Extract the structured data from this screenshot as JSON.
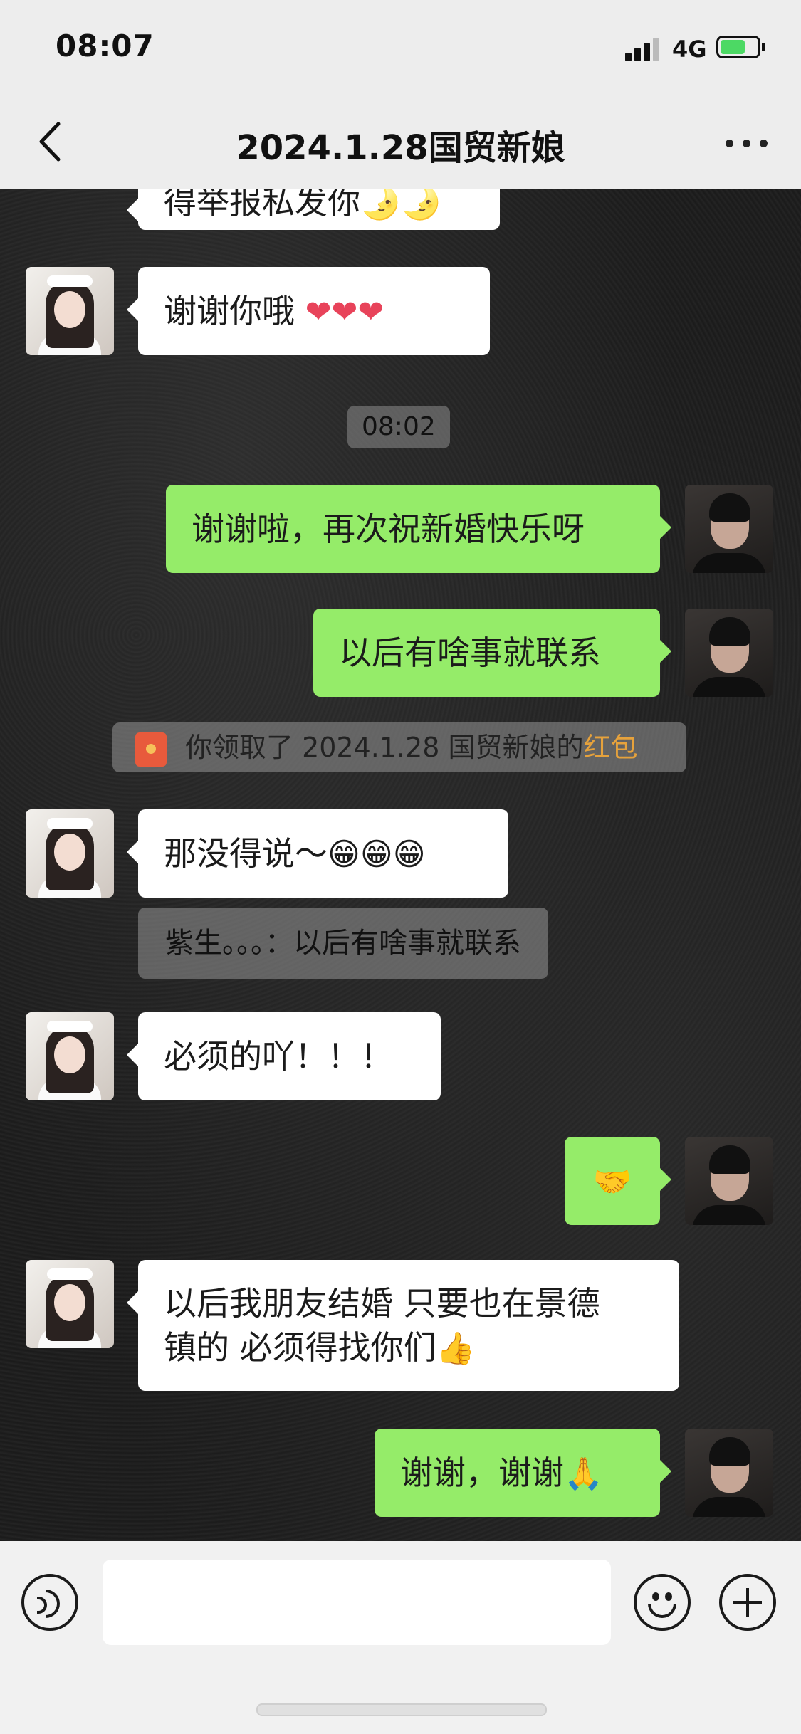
{
  "status_bar": {
    "time": "08:07",
    "network": "4G"
  },
  "header": {
    "title": "2024.1.28国贸新娘"
  },
  "messages": {
    "m0": {
      "text": "得举报私发你🌛🌛"
    },
    "m1": {
      "text": "谢谢你哦 ",
      "emoji": "❤❤❤"
    },
    "timestamp": "08:02",
    "m2": {
      "text": "谢谢啦，再次祝新婚快乐呀"
    },
    "m3": {
      "text": "以后有啥事就联系"
    },
    "system": {
      "prefix": "你领取了 2024.1.28 国贸新娘的",
      "highlight": "红包"
    },
    "m4": {
      "text": "那没得说～",
      "emoji": "😁😁😁"
    },
    "quote": {
      "text": "紫生。。。：以后有啥事就联系"
    },
    "m5": {
      "text": "必须的吖！！！"
    },
    "m6": {
      "emoji": "🤝"
    },
    "m7": {
      "line1": "以后我朋友结婚 只要也在景德",
      "line2": "镇的 必须得找你们",
      "emoji": "👍"
    },
    "m8": {
      "text": "谢谢，谢谢",
      "emoji": "🙏"
    }
  },
  "colors": {
    "outgoing_bubble": "#95ec69",
    "incoming_bubble": "#ffffff",
    "red_packet_text": "#e6a23c"
  }
}
